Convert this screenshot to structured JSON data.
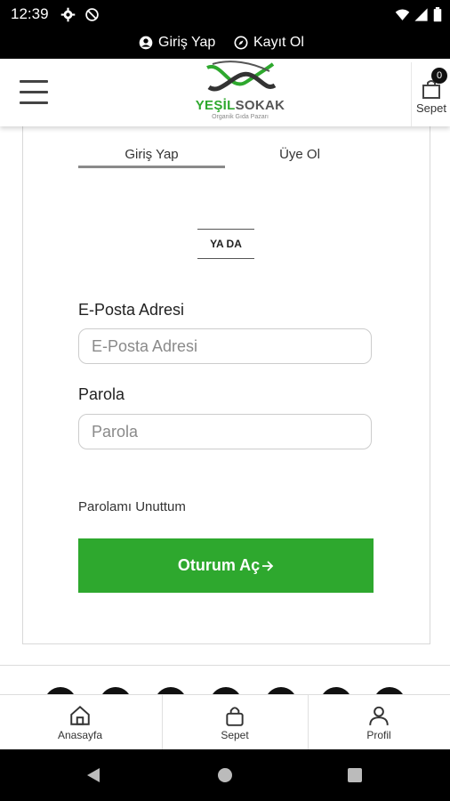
{
  "status_bar": {
    "time": "12:39"
  },
  "top_links": {
    "login": "Giriş Yap",
    "register": "Kayıt Ol"
  },
  "header": {
    "brand_green": "YEŞİL",
    "brand_gray": "SOKAK",
    "tagline": "Organik Gıda Pazarı",
    "cart_count": "0",
    "cart_label": "Sepet"
  },
  "tabs": {
    "login": "Giriş Yap",
    "signup": "Üye Ol"
  },
  "divider_text": "YA DA",
  "form": {
    "email_label": "E-Posta Adresi",
    "email_placeholder": "E-Posta Adresi",
    "password_label": "Parola",
    "password_placeholder": "Parola",
    "forgot_link": "Parolamı Unuttum",
    "submit_label": "Oturum Aç"
  },
  "bottom_nav": {
    "home": "Anasayfa",
    "cart": "Sepet",
    "profile": "Profil"
  },
  "colors": {
    "accent": "#2ea82e",
    "bar": "#000000"
  },
  "icons": [
    "account-circle-icon",
    "compass-icon",
    "settings-icon",
    "blocked-icon",
    "wifi-icon",
    "signal-icon",
    "battery-icon",
    "hamburger-menu-icon",
    "shopping-bag-icon",
    "arrow-right-icon",
    "home-icon",
    "lock-icon",
    "user-icon",
    "back-icon",
    "home-circle-icon",
    "recents-icon"
  ]
}
